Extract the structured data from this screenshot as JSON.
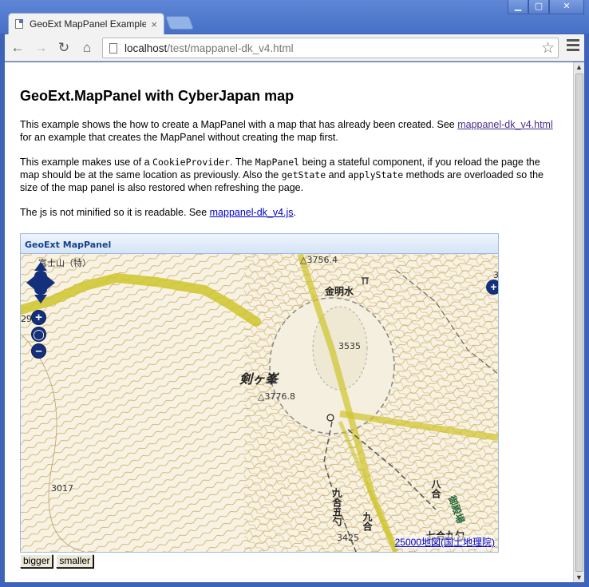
{
  "browser": {
    "tab_title": "GeoExt MapPanel Example",
    "tab_close": "×",
    "url_host": "localhost",
    "url_path": "/test/mappanel-dk_v4.html"
  },
  "page": {
    "title": "GeoExt.MapPanel with CyberJapan map",
    "p1_text": "This example shows the how to create a MapPanel with a map that has already been created. See ",
    "p1_link": "mappanel-dk_v4.html",
    "p1_tail": " for an example that creates the MapPanel without creating the map first.",
    "p2_a": "This example makes use of a ",
    "p2_code1": "CookieProvider",
    "p2_b": ". The ",
    "p2_code2": "MapPanel",
    "p2_c": " being a stateful component, if you reload the page the map should be at the same location as previously. Also the ",
    "p2_code3": "getState",
    "p2_d": " and ",
    "p2_code4": "applyState",
    "p2_e": " methods are overloaded so the size of the map panel is also restored when refreshing the page.",
    "p3_text": "The js is not minified so it is readable. See ",
    "p3_link": "mappanel-dk_v4.js",
    "p3_tail": "."
  },
  "mappanel": {
    "header": "GeoExt MapPanel",
    "attribution": "25000地図(国土地理院)",
    "labels": {
      "fuji": "富士山（特）",
      "alt1": "△3756.4",
      "kinmeisui": "金明水",
      "alt2": "3535",
      "kengamine": "剣ヶ峯",
      "alt3": "△3776.8",
      "alt4": "3017",
      "kyugou5": "九合五勺",
      "kyugou": "九合",
      "hachigou": "八合",
      "alt5": "3425",
      "nanagou": "七合九勺",
      "gotemba": "御殿場",
      "edge_num": "29",
      "edge_3": "3"
    }
  },
  "buttons": {
    "bigger": "bigger",
    "smaller": "smaller"
  },
  "colors": {
    "link": "#4b2d8a",
    "panel_header_text": "#15428b",
    "map_control": "#15307a"
  }
}
